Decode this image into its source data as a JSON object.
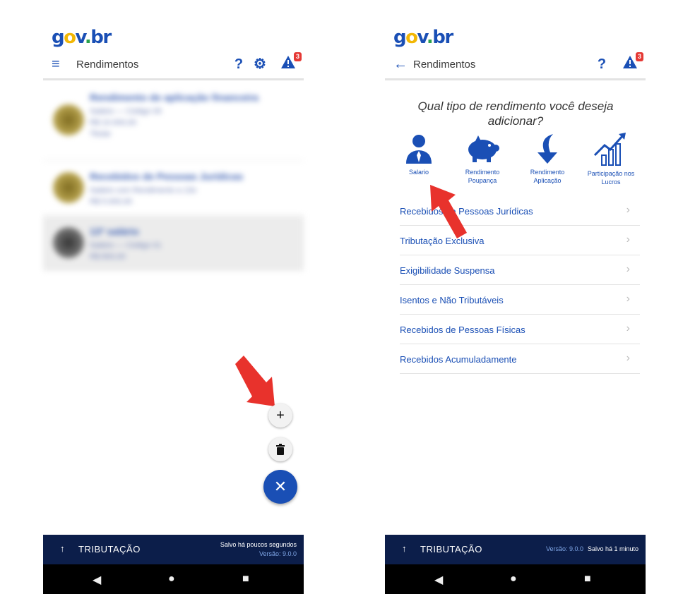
{
  "logo": {
    "g": "g",
    "o": "o",
    "v": "v",
    "dot": ".",
    "br": "br"
  },
  "left": {
    "title": "Rendimentos",
    "menu_icon": "≡",
    "help": "?",
    "gear": "⚙",
    "alert_badge": "3",
    "blur_items": [
      {
        "line1": "Rendimento de aplicação financeira",
        "line2": "Salário — Código 09",
        "line3": "R$ 10.000,00",
        "line4": "Titular"
      },
      {
        "line1": "Recebidos de Pessoas Jurídicas",
        "line2": "Salário com Rendimento a 13o",
        "line3": "R$ 5.000,00"
      },
      {
        "line1": "13º salário",
        "line2": "Salário — Código 01",
        "line3": "R$ 800,00"
      }
    ],
    "fab_add": "+",
    "fab_delete": "🗑",
    "fab_close": "✕",
    "bottom": {
      "up": "↑",
      "label": "TRIBUTAÇÃO",
      "saved": "Salvo há poucos segundos",
      "version": "Versão: 9.0.0"
    },
    "nav": {
      "back": "◀",
      "home": "●",
      "recent": "■"
    }
  },
  "right": {
    "title": "Rendimentos",
    "back_icon": "←",
    "help": "?",
    "alert_badge": "3",
    "question": "Qual tipo de rendimento você deseja adicionar?",
    "categories": [
      {
        "label": "Salario",
        "icon": "person-suit-icon"
      },
      {
        "label": "Rendimento Poupança",
        "icon": "piggy-bank-icon"
      },
      {
        "label": "Rendimento Aplicação",
        "icon": "down-arrow-curve-icon"
      },
      {
        "label": "Participação nos Lucros",
        "icon": "growth-chart-icon"
      }
    ],
    "menu": [
      "Recebidos de Pessoas Jurídicas",
      "Tributação Exclusiva",
      "Exigibilidade Suspensa",
      "Isentos e Não Tributáveis",
      "Recebidos de Pessoas Físicas",
      "Recebidos Acumuladamente"
    ],
    "chevron": "›",
    "bottom": {
      "up": "↑",
      "label": "TRIBUTAÇÃO",
      "version": "Versão: 9.0.0",
      "saved": "Salvo há 1 minuto"
    },
    "nav": {
      "back": "◀",
      "home": "●",
      "recent": "■"
    }
  },
  "colors": {
    "brand_blue": "#1a4fb5",
    "bar_navy": "#0c1e4a",
    "arrow_red": "#e8322c"
  }
}
